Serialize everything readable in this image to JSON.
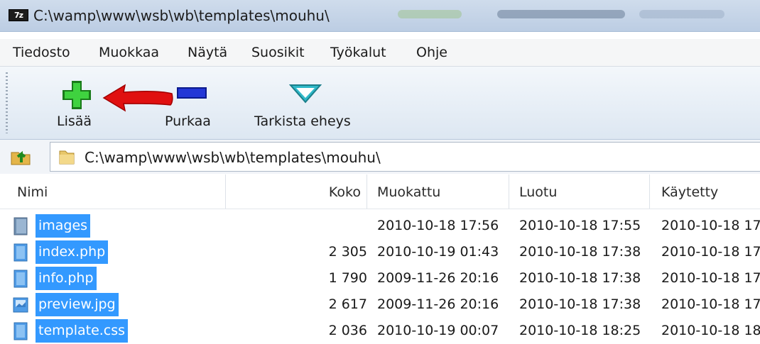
{
  "window": {
    "title": "C:\\wamp\\www\\wsb\\wb\\templates\\mouhu\\",
    "logo_text": "7z"
  },
  "menu": {
    "items": [
      {
        "label": "Tiedosto"
      },
      {
        "label": "Muokkaa"
      },
      {
        "label": "Näytä"
      },
      {
        "label": "Suosikit"
      },
      {
        "label": "Työkalut"
      },
      {
        "label": "Ohje"
      }
    ]
  },
  "toolbar": {
    "add_label": "Lisää",
    "extract_label": "Purkaa",
    "test_label": "Tarkista eheys",
    "colors": {
      "add": "#22bb22",
      "extract": "#1a2fbf",
      "test": "#35d6e6",
      "arrow": "#e01010"
    }
  },
  "address": {
    "path": "C:\\wamp\\www\\wsb\\wb\\templates\\mouhu\\"
  },
  "list": {
    "columns": [
      "Nimi",
      "Koko",
      "Muokattu",
      "Luotu",
      "Käytetty"
    ],
    "rows": [
      {
        "name": "images",
        "icon": "folder-icon",
        "size": "",
        "modified": "2010-10-18 17:56",
        "created": "2010-10-18 17:55",
        "accessed": "2010-10-18 17"
      },
      {
        "name": "index.php",
        "icon": "file-icon",
        "size": "2 305",
        "modified": "2010-10-19 01:43",
        "created": "2010-10-18 17:38",
        "accessed": "2010-10-18 17"
      },
      {
        "name": "info.php",
        "icon": "file-icon",
        "size": "1 790",
        "modified": "2009-11-26 20:16",
        "created": "2010-10-18 17:38",
        "accessed": "2010-10-18 17"
      },
      {
        "name": "preview.jpg",
        "icon": "image-file-icon",
        "size": "2 617",
        "modified": "2009-11-26 20:16",
        "created": "2010-10-18 17:38",
        "accessed": "2010-10-18 17"
      },
      {
        "name": "template.css",
        "icon": "file-icon",
        "size": "2 036",
        "modified": "2010-10-19 00:07",
        "created": "2010-10-18 18:25",
        "accessed": "2010-10-18 18"
      }
    ],
    "selection_color": "#3399ff"
  }
}
